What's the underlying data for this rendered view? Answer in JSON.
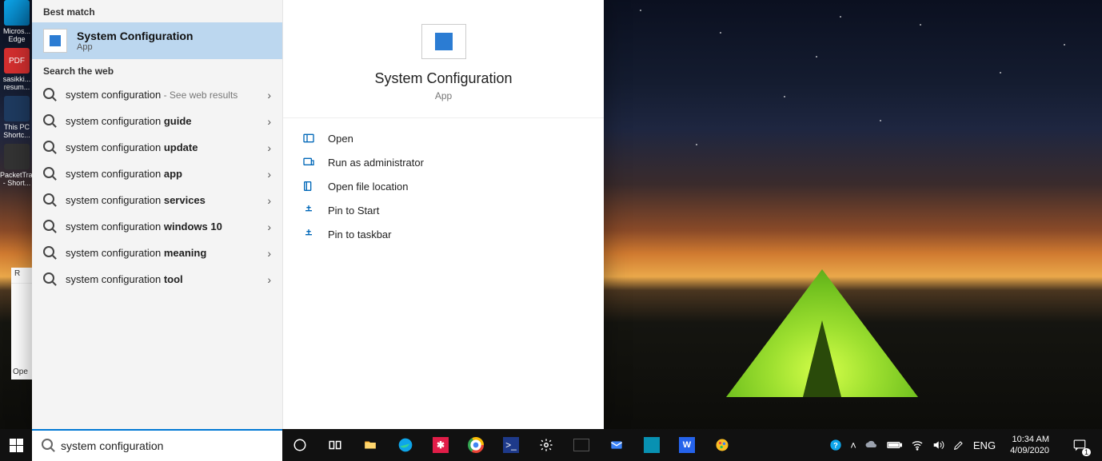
{
  "desktop_icons": [
    {
      "label": "Micros... Edge"
    },
    {
      "label": "PDF"
    },
    {
      "label": "sasikki... resum..."
    },
    {
      "label": "This PC Shortc..."
    },
    {
      "label": "PacketTra... - Short..."
    }
  ],
  "run": {
    "header": "R",
    "open": "Ope"
  },
  "search": {
    "best_match_header": "Best match",
    "best_match": {
      "title": "System Configuration",
      "subtitle": "App"
    },
    "web_header": "Search the web",
    "web_results": [
      {
        "base": "system configuration",
        "bold": "",
        "hint": " - See web results"
      },
      {
        "base": "system configuration ",
        "bold": "guide",
        "hint": ""
      },
      {
        "base": "system configuration ",
        "bold": "update",
        "hint": ""
      },
      {
        "base": "system configuration ",
        "bold": "app",
        "hint": ""
      },
      {
        "base": "system configuration ",
        "bold": "services",
        "hint": ""
      },
      {
        "base": "system configuration ",
        "bold": "windows 10",
        "hint": ""
      },
      {
        "base": "system configuration ",
        "bold": "meaning",
        "hint": ""
      },
      {
        "base": "system configuration ",
        "bold": "tool",
        "hint": ""
      }
    ],
    "detail": {
      "title": "System Configuration",
      "subtitle": "App"
    },
    "actions": {
      "open": "Open",
      "run_admin": "Run as administrator",
      "open_file_location": "Open file location",
      "pin_start": "Pin to Start",
      "pin_taskbar": "Pin to taskbar"
    },
    "query": "system configuration"
  },
  "tray": {
    "lang": "ENG",
    "time": "10:34 AM",
    "date": "4/09/2020",
    "notif_count": "1"
  }
}
